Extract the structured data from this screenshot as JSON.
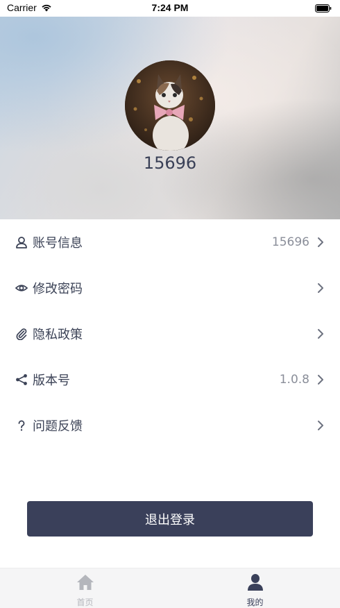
{
  "status_bar": {
    "carrier": "Carrier",
    "time": "7:24 PM"
  },
  "profile": {
    "username": "15696"
  },
  "menu": {
    "items": [
      {
        "label": "账号信息",
        "value": "15696",
        "icon": "user-icon"
      },
      {
        "label": "修改密码",
        "value": "",
        "icon": "eye-icon"
      },
      {
        "label": "隐私政策",
        "value": "",
        "icon": "paperclip-icon"
      },
      {
        "label": "版本号",
        "value": "1.0.8",
        "icon": "share-icon"
      },
      {
        "label": "问题反馈",
        "value": "",
        "icon": "question-icon"
      }
    ]
  },
  "logout": {
    "label": "退出登录"
  },
  "tabbar": {
    "tabs": [
      {
        "label": "首页",
        "icon": "home-icon",
        "active": false
      },
      {
        "label": "我的",
        "icon": "person-icon",
        "active": true
      }
    ]
  },
  "colors": {
    "primary": "#3a405a",
    "text": "#3b4256",
    "muted": "#8a8e99",
    "tab_inactive": "#b4b6bc",
    "tabbar_bg": "#f5f5f6"
  }
}
